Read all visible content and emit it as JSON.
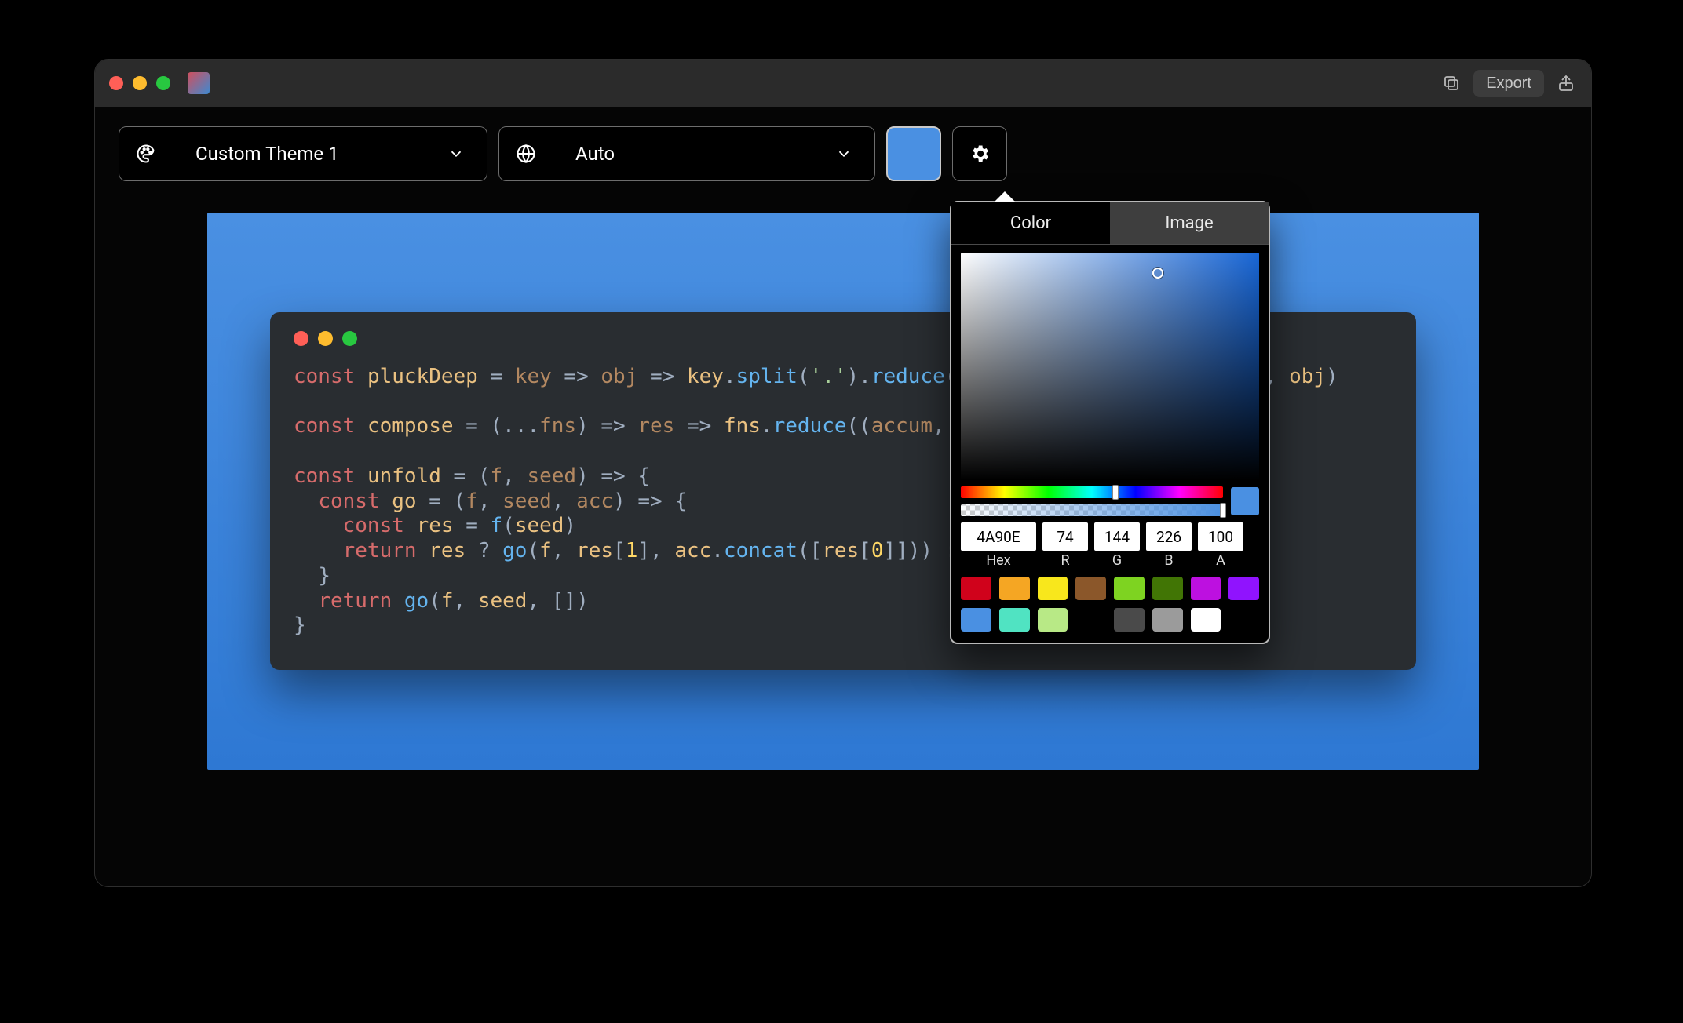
{
  "titlebar": {
    "export_label": "Export"
  },
  "toolbar": {
    "theme_label": "Custom Theme 1",
    "lang_label": "Auto",
    "swatch_color": "#4A90E2"
  },
  "popover": {
    "tab_color": "Color",
    "tab_image": "Image",
    "active_tab": "Color",
    "hex": "4A90E",
    "r": "74",
    "g": "144",
    "b": "226",
    "a": "100",
    "label_hex": "Hex",
    "label_r": "R",
    "label_g": "G",
    "label_b": "B",
    "label_a": "A",
    "hue_pos_pct": 59,
    "alpha_pos_pct": 100,
    "current_color": "#4A90E2",
    "presets": [
      "#d0021b",
      "#f5a623",
      "#f8e71c",
      "#8b572a",
      "#7ed321",
      "#417505",
      "#bd10e0",
      "#9013fe",
      "#4a90e2",
      "#50e3c2",
      "#b8e986",
      "#000000",
      "#4a4a4a",
      "#9b9b9b",
      "#ffffff"
    ]
  },
  "code": {
    "tokens": [
      [
        [
          "kw",
          "const"
        ],
        [
          "sp",
          " "
        ],
        [
          "id",
          "pluckDeep"
        ],
        [
          "sp",
          " "
        ],
        [
          "op",
          "="
        ],
        [
          "sp",
          " "
        ],
        [
          "arg",
          "key"
        ],
        [
          "sp",
          " "
        ],
        [
          "op",
          "=>"
        ],
        [
          "sp",
          " "
        ],
        [
          "arg",
          "obj"
        ],
        [
          "sp",
          " "
        ],
        [
          "op",
          "=>"
        ],
        [
          "sp",
          " "
        ],
        [
          "id",
          "key"
        ],
        [
          "op",
          "."
        ],
        [
          "call",
          "split"
        ],
        [
          "op",
          "("
        ],
        [
          "str",
          "'.'"
        ],
        [
          "op",
          ")."
        ],
        [
          "call",
          "reduce"
        ],
        [
          "op",
          "("
        ],
        [
          "sp",
          "                         "
        ],
        [
          "op",
          ","
        ],
        [
          "sp",
          " "
        ],
        [
          "id",
          "obj"
        ],
        [
          "op",
          ")"
        ]
      ],
      [],
      [
        [
          "kw",
          "const"
        ],
        [
          "sp",
          " "
        ],
        [
          "id",
          "compose"
        ],
        [
          "sp",
          " "
        ],
        [
          "op",
          "="
        ],
        [
          "sp",
          " "
        ],
        [
          "op",
          "(..."
        ],
        [
          "arg",
          "fns"
        ],
        [
          "op",
          ")"
        ],
        [
          "sp",
          " "
        ],
        [
          "op",
          "=>"
        ],
        [
          "sp",
          " "
        ],
        [
          "arg",
          "res"
        ],
        [
          "sp",
          " "
        ],
        [
          "op",
          "=>"
        ],
        [
          "sp",
          " "
        ],
        [
          "id",
          "fns"
        ],
        [
          "op",
          "."
        ],
        [
          "call",
          "reduce"
        ],
        [
          "op",
          "(("
        ],
        [
          "arg",
          "accum"
        ],
        [
          "op",
          ","
        ]
      ],
      [],
      [
        [
          "kw",
          "const"
        ],
        [
          "sp",
          " "
        ],
        [
          "id",
          "unfold"
        ],
        [
          "sp",
          " "
        ],
        [
          "op",
          "="
        ],
        [
          "sp",
          " "
        ],
        [
          "op",
          "("
        ],
        [
          "arg",
          "f"
        ],
        [
          "op",
          ","
        ],
        [
          "sp",
          " "
        ],
        [
          "arg",
          "seed"
        ],
        [
          "op",
          ")"
        ],
        [
          "sp",
          " "
        ],
        [
          "op",
          "=>"
        ],
        [
          "sp",
          " "
        ],
        [
          "op",
          "{"
        ]
      ],
      [
        [
          "sp",
          "  "
        ],
        [
          "kw",
          "const"
        ],
        [
          "sp",
          " "
        ],
        [
          "id",
          "go"
        ],
        [
          "sp",
          " "
        ],
        [
          "op",
          "="
        ],
        [
          "sp",
          " "
        ],
        [
          "op",
          "("
        ],
        [
          "arg",
          "f"
        ],
        [
          "op",
          ","
        ],
        [
          "sp",
          " "
        ],
        [
          "arg",
          "seed"
        ],
        [
          "op",
          ","
        ],
        [
          "sp",
          " "
        ],
        [
          "arg",
          "acc"
        ],
        [
          "op",
          ")"
        ],
        [
          "sp",
          " "
        ],
        [
          "op",
          "=>"
        ],
        [
          "sp",
          " "
        ],
        [
          "op",
          "{"
        ]
      ],
      [
        [
          "sp",
          "    "
        ],
        [
          "kw",
          "const"
        ],
        [
          "sp",
          " "
        ],
        [
          "id",
          "res"
        ],
        [
          "sp",
          " "
        ],
        [
          "op",
          "="
        ],
        [
          "sp",
          " "
        ],
        [
          "call",
          "f"
        ],
        [
          "op",
          "("
        ],
        [
          "id",
          "seed"
        ],
        [
          "op",
          ")"
        ]
      ],
      [
        [
          "sp",
          "    "
        ],
        [
          "kw",
          "return"
        ],
        [
          "sp",
          " "
        ],
        [
          "id",
          "res"
        ],
        [
          "sp",
          " "
        ],
        [
          "op",
          "?"
        ],
        [
          "sp",
          " "
        ],
        [
          "call",
          "go"
        ],
        [
          "op",
          "("
        ],
        [
          "id",
          "f"
        ],
        [
          "op",
          ","
        ],
        [
          "sp",
          " "
        ],
        [
          "id",
          "res"
        ],
        [
          "op",
          "["
        ],
        [
          "num",
          "1"
        ],
        [
          "op",
          "],"
        ],
        [
          "sp",
          " "
        ],
        [
          "id",
          "acc"
        ],
        [
          "op",
          "."
        ],
        [
          "call",
          "concat"
        ],
        [
          "op",
          "(["
        ],
        [
          "id",
          "res"
        ],
        [
          "op",
          "["
        ],
        [
          "num",
          "0"
        ],
        [
          "op",
          "]]))"
        ],
        [
          "sp",
          " "
        ],
        [
          "op",
          ":"
        ]
      ],
      [
        [
          "sp",
          "  "
        ],
        [
          "op",
          "}"
        ]
      ],
      [
        [
          "sp",
          "  "
        ],
        [
          "kw",
          "return"
        ],
        [
          "sp",
          " "
        ],
        [
          "call",
          "go"
        ],
        [
          "op",
          "("
        ],
        [
          "id",
          "f"
        ],
        [
          "op",
          ","
        ],
        [
          "sp",
          " "
        ],
        [
          "id",
          "seed"
        ],
        [
          "op",
          ","
        ],
        [
          "sp",
          " "
        ],
        [
          "op",
          "[])"
        ]
      ],
      [
        [
          "op",
          "}"
        ]
      ]
    ]
  }
}
